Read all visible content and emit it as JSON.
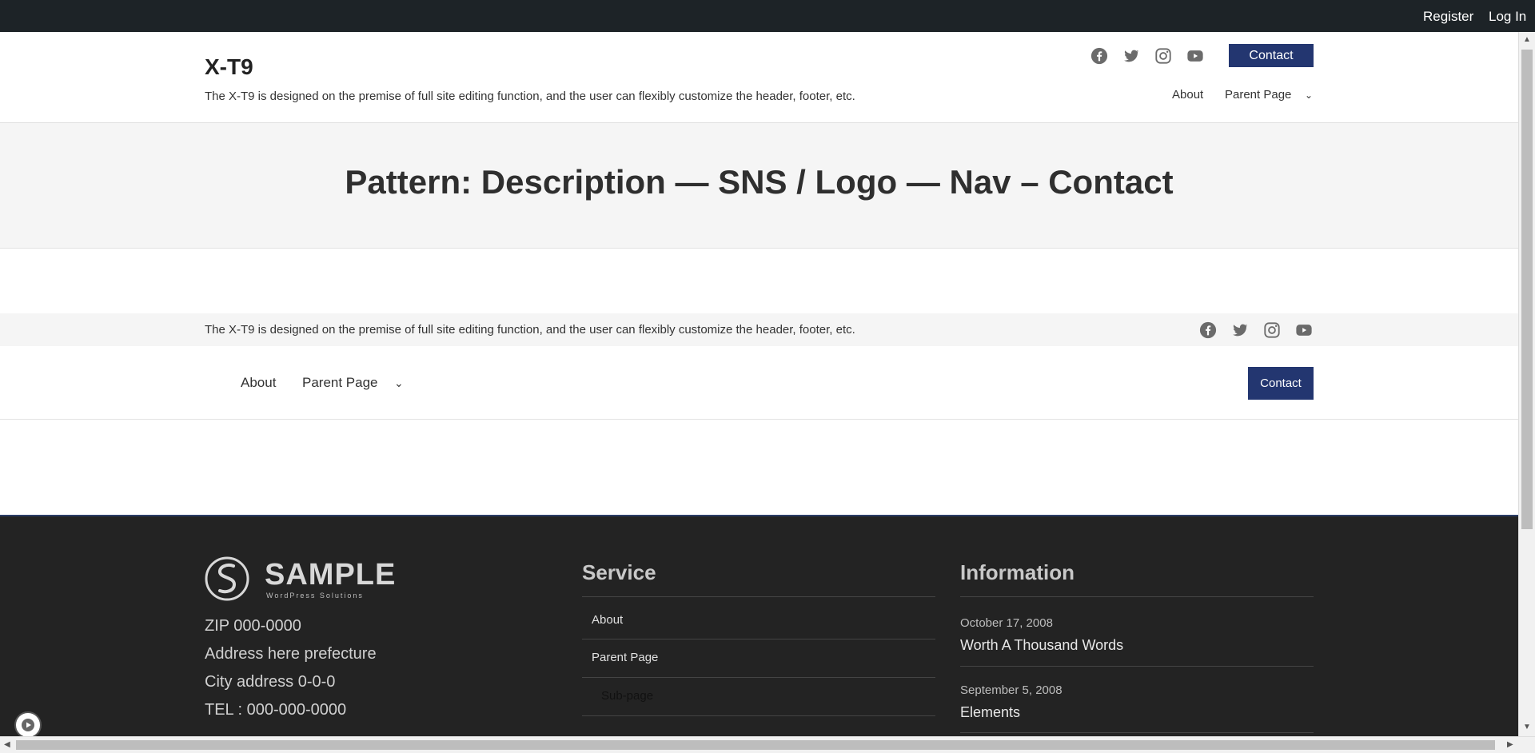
{
  "adminbar": {
    "register": "Register",
    "login": "Log In"
  },
  "header": {
    "title": "X-T9",
    "description": "The X-T9 is designed on the premise of full site editing function, and the user can flexibly customize the header, footer, etc.",
    "contact": "Contact",
    "nav": [
      "About",
      "Parent Page"
    ]
  },
  "hero": {
    "title": "Pattern: Description — SNS / Logo — Nav – Contact"
  },
  "pattern": {
    "description": "The X-T9 is designed on the premise of full site editing function, and the user can flexibly customize the header, footer, etc.",
    "nav": [
      "About",
      "Parent Page"
    ],
    "contact": "Contact"
  },
  "sns_icons": [
    "facebook-icon",
    "twitter-icon",
    "instagram-icon",
    "youtube-icon"
  ],
  "footer": {
    "logo": {
      "word": "SAMPLE",
      "tagline": "WordPress Solutions"
    },
    "address": [
      "ZIP 000-0000",
      "Address here prefecture",
      "City address 0-0-0",
      "TEL : 000-000-0000"
    ],
    "service": {
      "heading": "Service",
      "links": [
        "About",
        "Parent Page",
        "Sub-page"
      ]
    },
    "information": {
      "heading": "Information",
      "posts": [
        {
          "date": "October 17, 2008",
          "title": "Worth A Thousand Words"
        },
        {
          "date": "September 5, 2008",
          "title": "Elements"
        }
      ]
    }
  },
  "colors": {
    "adminbar": "#1d2327",
    "accent": "#233670",
    "footer": "#232323",
    "hero": "#f5f5f5"
  }
}
